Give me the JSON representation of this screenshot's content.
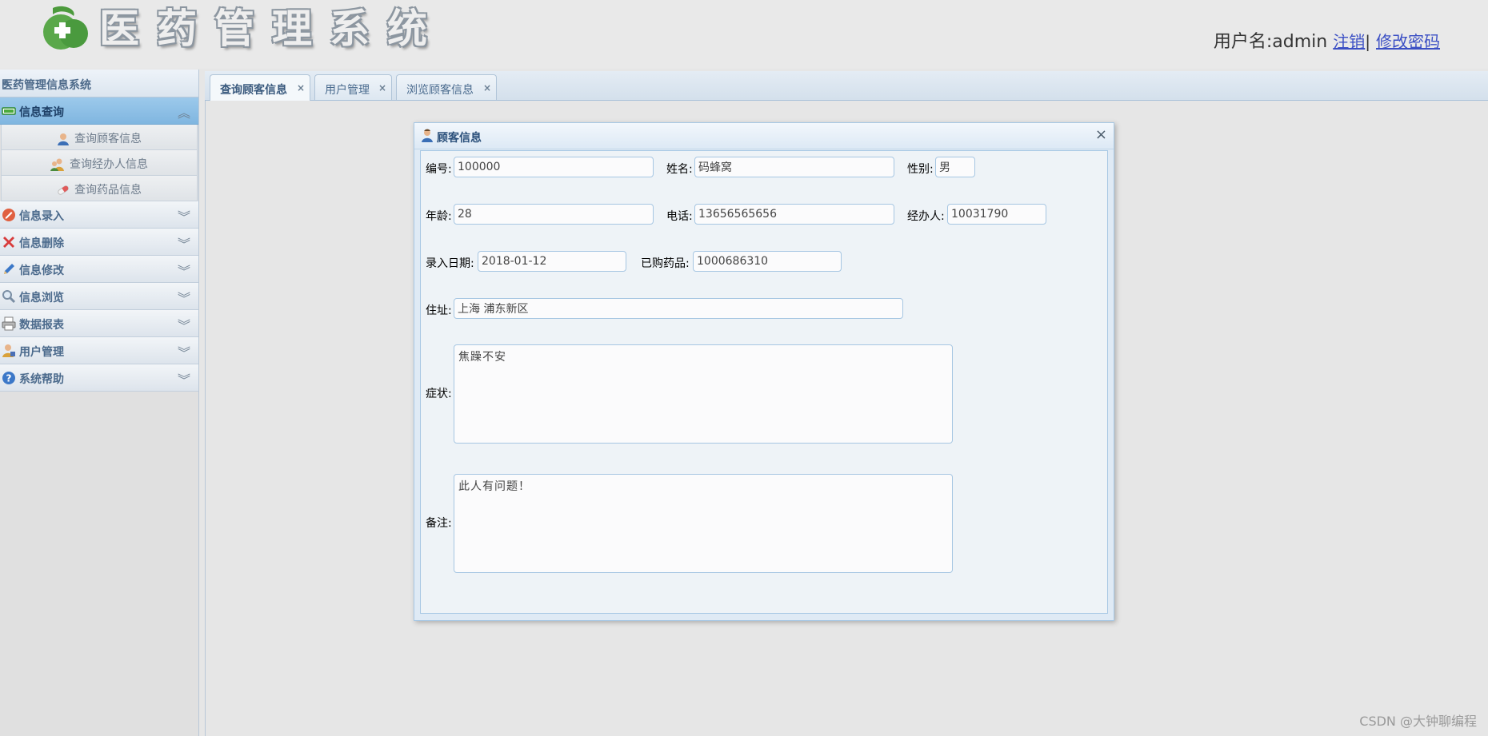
{
  "header": {
    "logo_chars": [
      "医",
      "药",
      "管",
      "理",
      "系",
      "统"
    ],
    "user_label": "用户名:admin",
    "logout_link": "注销",
    "separator": "|",
    "change_password_link": "修改密码"
  },
  "sidebar": {
    "title": "医药管理信息系统",
    "collapse_icon": "«",
    "groups": [
      {
        "label": "信息查询",
        "icon": "query-icon"
      },
      {
        "label": "信息录入",
        "icon": "entry-icon"
      },
      {
        "label": "信息删除",
        "icon": "delete-icon"
      },
      {
        "label": "信息修改",
        "icon": "edit-icon"
      },
      {
        "label": "信息浏览",
        "icon": "browse-icon"
      },
      {
        "label": "数据报表",
        "icon": "report-icon"
      },
      {
        "label": "用户管理",
        "icon": "user-manage-icon"
      },
      {
        "label": "系统帮助",
        "icon": "help-icon"
      }
    ],
    "sub_items": [
      {
        "label": "查询顾客信息",
        "icon": "customer-icon"
      },
      {
        "label": "查询经办人信息",
        "icon": "agent-icon"
      },
      {
        "label": "查询药品信息",
        "icon": "pill-icon"
      }
    ]
  },
  "tabs": [
    {
      "label": "查询顾客信息",
      "close": "×"
    },
    {
      "label": "用户管理",
      "close": "×"
    },
    {
      "label": "浏览顾客信息",
      "close": "×"
    }
  ],
  "dialog": {
    "title": "顾客信息",
    "close": "×",
    "fields": {
      "id": {
        "label": "编号:",
        "value": "100000"
      },
      "name": {
        "label": "姓名:",
        "value": "码蜂窝"
      },
      "gender": {
        "label": "性别:",
        "value": "男"
      },
      "age": {
        "label": "年龄:",
        "value": "28"
      },
      "phone": {
        "label": "电话:",
        "value": "13656565656"
      },
      "agent": {
        "label": "经办人:",
        "value": "10031790"
      },
      "date": {
        "label": "录入日期:",
        "value": "2018-01-12"
      },
      "medicine": {
        "label": "已购药品:",
        "value": "1000686310"
      },
      "address": {
        "label": "住址:",
        "value": "上海 浦东新区"
      },
      "symptom": {
        "label": "症状:",
        "value": "焦躁不安"
      },
      "remark": {
        "label": "备注:",
        "value": "此人有问题！"
      }
    }
  },
  "watermark": "CSDN @大钟聊编程"
}
